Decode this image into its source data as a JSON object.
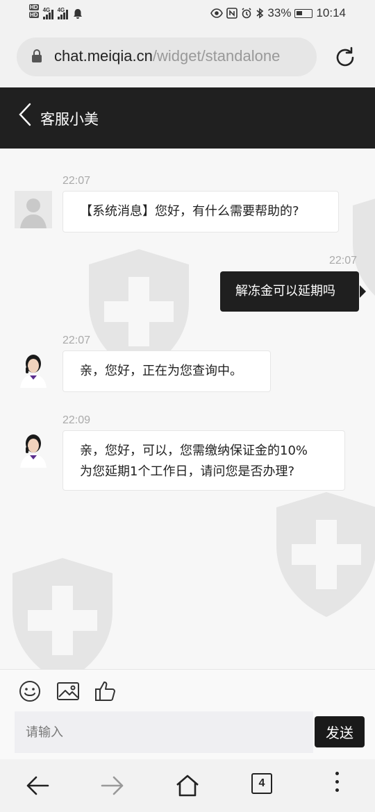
{
  "status_bar": {
    "hd1": "HD",
    "hd2": "HD",
    "net1": "4G",
    "net2": "4G",
    "battery": "33%",
    "time": "10:14",
    "icons": [
      "eye-icon",
      "nfc-icon",
      "alarm-icon",
      "bluetooth-icon",
      "battery-icon"
    ]
  },
  "browser": {
    "url_host": "chat.meiqia.cn",
    "url_path": "/widget/standalone"
  },
  "header": {
    "title": "客服小美"
  },
  "messages": [
    {
      "time": "22:07",
      "side": "agent",
      "avatar": "default",
      "text": "【系统消息】您好，有什么需要帮助的?"
    },
    {
      "time": "22:07",
      "side": "user",
      "text": "解冻金可以延期吗"
    },
    {
      "time": "22:07",
      "side": "agent",
      "avatar": "agent-photo",
      "text": "亲，您好，正在为您查询中。"
    },
    {
      "time": "22:09",
      "side": "agent",
      "avatar": "agent-photo",
      "line1": "亲，您好，可以，您需缴纳保证金的10%",
      "line2": "为您延期1个工作日，请问您是否办理?"
    }
  ],
  "composer": {
    "placeholder": "请输入",
    "send_label": "发送",
    "tools": [
      "emoji-icon",
      "image-icon",
      "thumbs-up-icon"
    ]
  },
  "nav": {
    "tab_count": "4",
    "icons": [
      "back-arrow-icon",
      "forward-arrow-icon",
      "home-icon",
      "tabs-icon",
      "menu-dots-icon"
    ]
  },
  "colors": {
    "header_bg": "#202020",
    "user_bubble": "#1f1f1f",
    "agent_bubble": "#ffffff",
    "page_bg": "#f7f7f7"
  }
}
